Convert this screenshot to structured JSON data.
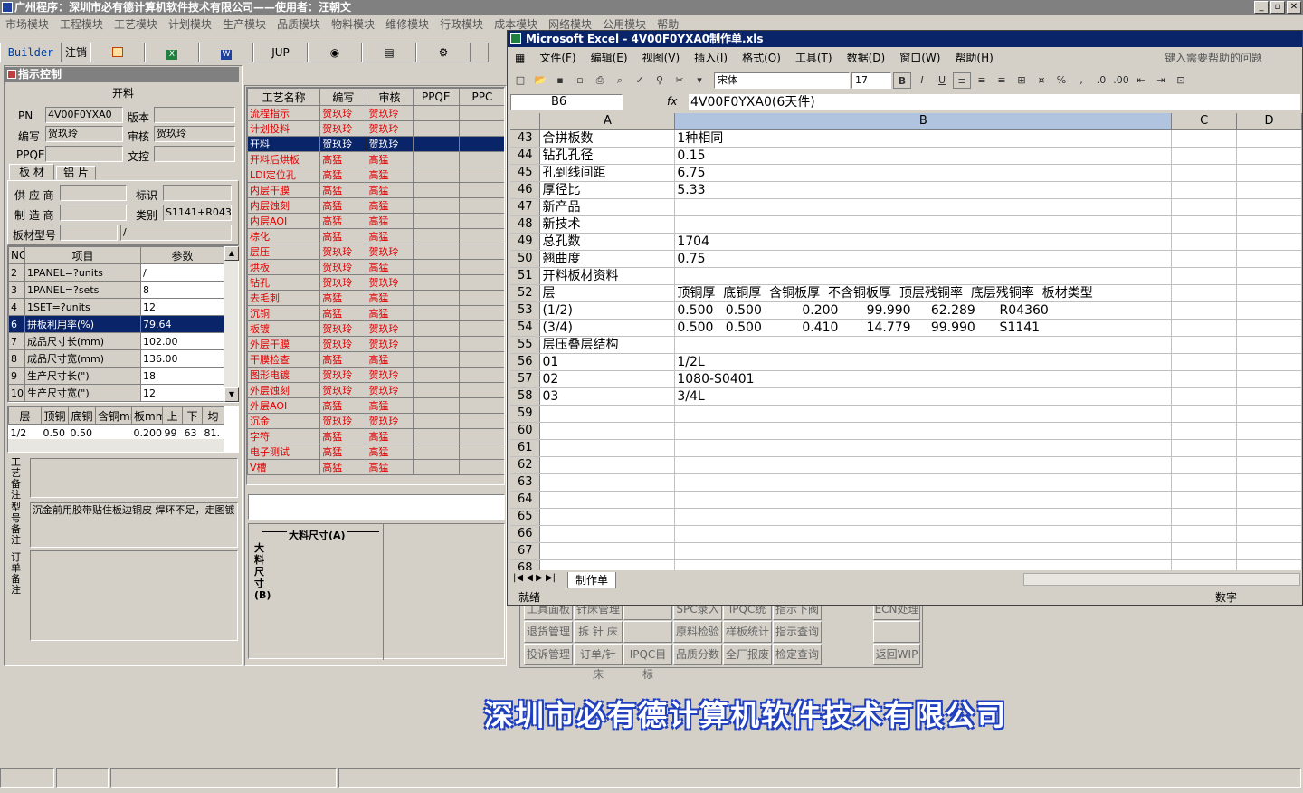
{
  "app": {
    "title": "广州程序：深圳市必有德计算机软件技术有限公司——使用者：汪朝文",
    "menu": [
      "市场模块",
      "工程模块",
      "工艺模块",
      "计划模块",
      "生产模块",
      "品质模块",
      "物料模块",
      "维修模块",
      "行政模块",
      "成本模块",
      "网络模块",
      "公用模块",
      "帮助"
    ],
    "toolbar": [
      "Builder",
      "注销",
      "",
      "",
      "",
      "JUP",
      "",
      "",
      "",
      ""
    ],
    "section_title": "指示控制"
  },
  "left": {
    "heading": "开料",
    "pn_label": "PN",
    "pn_value": "4V00F0YXA0",
    "version_label": "版本",
    "version_value": "",
    "writer_label": "编写",
    "writer_value": "贺玖玲",
    "review_label": "审核",
    "review_value": "贺玖玲",
    "ppqe_label": "PPQE",
    "ppqe_value": "",
    "wenkong_label": "文控",
    "wenkong_value": "",
    "tabs": [
      "板 材",
      "铝 片"
    ],
    "supplier_label": "供 应 商",
    "supplier_value": "",
    "mark_label": "标识",
    "mark_value": "",
    "maker_label": "制 造 商",
    "maker_value": "",
    "category_label": "类别",
    "category_value": "S1141+R0436",
    "model_label": "板材型号",
    "model_value": "",
    "model_value2": "/",
    "param_headers": [
      "NO",
      "项目",
      "参数"
    ],
    "params": [
      {
        "no": "2",
        "item": "1PANEL=?units",
        "val": "/"
      },
      {
        "no": "3",
        "item": "1PANEL=?sets",
        "val": "8"
      },
      {
        "no": "4",
        "item": "1SET=?units",
        "val": "12"
      },
      {
        "no": "6",
        "item": "拼板利用率(%)",
        "val": "79.64"
      },
      {
        "no": "7",
        "item": "成品尺寸长(mm)",
        "val": "102.00"
      },
      {
        "no": "8",
        "item": "成品尺寸宽(mm)",
        "val": "136.00"
      },
      {
        "no": "9",
        "item": "生产尺寸长(\")",
        "val": "18"
      },
      {
        "no": "10",
        "item": "生产尺寸宽(\")",
        "val": "12"
      }
    ],
    "layer_headers": [
      "层",
      "顶铜",
      "底铜",
      "含铜mm",
      "板mm",
      "上",
      "下",
      "均"
    ],
    "layer_row": [
      "1/2",
      "0.50",
      "0.50",
      "",
      "0.200",
      "99",
      "63",
      "81."
    ],
    "remark1_label": "工艺备注",
    "remark2_label": "型号备注",
    "remark2_text": "沉金前用胶带贴住板边铜皮    焊环不足，走图镀",
    "remark3_label": "订单备注"
  },
  "process": {
    "headers": [
      "工艺名称",
      "编写",
      "审核",
      "PPQE",
      "PPC"
    ],
    "rows": [
      [
        "流程指示",
        "贺玖玲",
        "贺玖玲"
      ],
      [
        "计划投料",
        "贺玖玲",
        "贺玖玲"
      ],
      [
        "开料",
        "贺玖玲",
        "贺玖玲"
      ],
      [
        "开料后烘板",
        "高猛",
        "高猛"
      ],
      [
        "LDI定位孔",
        "高猛",
        "高猛"
      ],
      [
        "内层干膜",
        "高猛",
        "高猛"
      ],
      [
        "内层蚀刻",
        "高猛",
        "高猛"
      ],
      [
        "内层AOI",
        "高猛",
        "高猛"
      ],
      [
        "棕化",
        "高猛",
        "高猛"
      ],
      [
        "层压",
        "贺玖玲",
        "贺玖玲"
      ],
      [
        "烘板",
        "贺玖玲",
        "高猛"
      ],
      [
        "钻孔",
        "贺玖玲",
        "贺玖玲"
      ],
      [
        "去毛刺",
        "高猛",
        "高猛"
      ],
      [
        "沉铜",
        "高猛",
        "高猛"
      ],
      [
        "板镀",
        "贺玖玲",
        "贺玖玲"
      ],
      [
        "外层干膜",
        "贺玖玲",
        "贺玖玲"
      ],
      [
        "干膜检查",
        "高猛",
        "高猛"
      ],
      [
        "图形电镀",
        "贺玖玲",
        "贺玖玲"
      ],
      [
        "外层蚀刻",
        "贺玖玲",
        "贺玖玲"
      ],
      [
        "外层AOI",
        "高猛",
        "高猛"
      ],
      [
        "沉金",
        "贺玖玲",
        "贺玖玲"
      ],
      [
        "字符",
        "高猛",
        "高猛"
      ],
      [
        "电子测试",
        "高猛",
        "高猛"
      ],
      [
        "V槽",
        "高猛",
        "高猛"
      ]
    ],
    "dim_a": "大料尺寸(A)",
    "dim_b": "大料尺寸(B)"
  },
  "excel": {
    "title": "Microsoft Excel - 4V00F0YXA0制作单.xls",
    "menu": [
      "文件(F)",
      "编辑(E)",
      "视图(V)",
      "插入(I)",
      "格式(O)",
      "工具(T)",
      "数据(D)",
      "窗口(W)",
      "帮助(H)"
    ],
    "help_box": "键入需要帮助的问题",
    "font_name": "宋体",
    "font_size": "17",
    "cell_ref": "B6",
    "fx": "fx",
    "formula": "4V00F0YXA0(6天件)",
    "columns": [
      "A",
      "B",
      "C",
      "D"
    ],
    "rows": [
      {
        "n": "43",
        "a": "合拼板数",
        "b": "1种相同"
      },
      {
        "n": "44",
        "a": "钻孔孔径",
        "b": "0.15"
      },
      {
        "n": "45",
        "a": "孔到线间距",
        "b": "6.75"
      },
      {
        "n": "46",
        "a": "厚径比",
        "b": "5.33"
      },
      {
        "n": "47",
        "a": "新产品",
        "b": ""
      },
      {
        "n": "48",
        "a": "新技术",
        "b": ""
      },
      {
        "n": "49",
        "a": "总孔数",
        "b": "1704"
      },
      {
        "n": "50",
        "a": "翘曲度",
        "b": "0.75"
      },
      {
        "n": "51",
        "a": "开料板材资料",
        "b": ""
      },
      {
        "n": "52",
        "a": "层",
        "b": "顶铜厚  底铜厚  含铜板厚  不含铜板厚  顶层残铜率  底层残铜率  板材类型"
      },
      {
        "n": "53",
        "a": "(1/2)",
        "b": "0.500   0.500          0.200       99.990     62.289      R04360"
      },
      {
        "n": "54",
        "a": "(3/4)",
        "b": "0.500   0.500          0.410       14.779     99.990      S1141"
      },
      {
        "n": "55",
        "a": "层压叠层结构",
        "b": ""
      },
      {
        "n": "56",
        "a": "01",
        "b": "1/2L"
      },
      {
        "n": "57",
        "a": "02",
        "b": "1080-S0401"
      },
      {
        "n": "58",
        "a": "03",
        "b": "3/4L"
      },
      {
        "n": "59",
        "a": "",
        "b": ""
      },
      {
        "n": "60",
        "a": "",
        "b": ""
      },
      {
        "n": "61",
        "a": "",
        "b": ""
      },
      {
        "n": "62",
        "a": "",
        "b": ""
      },
      {
        "n": "63",
        "a": "",
        "b": ""
      },
      {
        "n": "64",
        "a": "",
        "b": ""
      },
      {
        "n": "65",
        "a": "",
        "b": ""
      },
      {
        "n": "66",
        "a": "",
        "b": ""
      },
      {
        "n": "67",
        "a": "",
        "b": ""
      },
      {
        "n": "68",
        "a": "",
        "b": ""
      }
    ],
    "sheet_tab": "制作单",
    "status_ready": "就绪",
    "status_num": "数字"
  },
  "bg_buttons": {
    "row0": [
      "工具面板",
      "针床管理",
      "",
      "SPC录入",
      "IPQC统计",
      "指示下阀",
      "ECN处理"
    ],
    "row1": [
      "退货管理",
      "拆 针 床",
      "",
      "原料检验",
      "样板统计",
      "指示查询",
      ""
    ],
    "row2": [
      "投诉管理",
      "订单/针床",
      "IPQC目标",
      "品质分数",
      "全厂报废",
      "检定查询",
      "返回WIP"
    ]
  },
  "company_logo": "深圳市必有德计算机软件技术有限公司"
}
